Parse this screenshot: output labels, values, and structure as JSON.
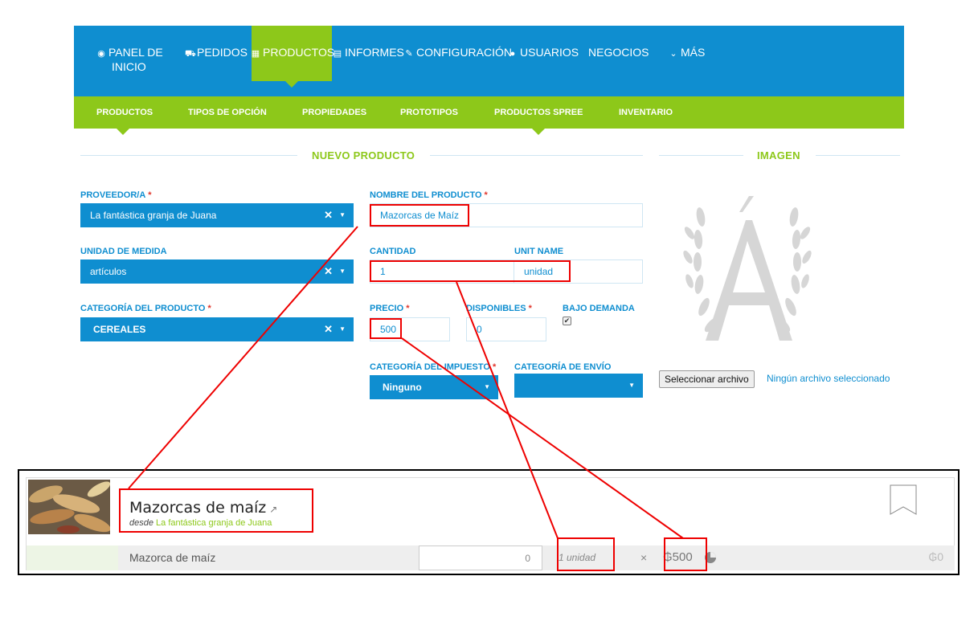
{
  "topnav": {
    "items": [
      {
        "icon": "dashboard-icon",
        "glyph": "◉",
        "label_line1": "PANEL DE",
        "label_line2": "INICIO"
      },
      {
        "icon": "cart-icon",
        "glyph": "⛟",
        "label": "PEDIDOS"
      },
      {
        "icon": "grid-icon",
        "glyph": "▦",
        "label": "PRODUCTOS"
      },
      {
        "icon": "document-icon",
        "glyph": "▤",
        "label": "INFORMES"
      },
      {
        "icon": "wrench-icon",
        "glyph": "✎",
        "label": "CONFIGURACIÓN"
      },
      {
        "icon": "user-icon",
        "glyph": "●",
        "label": "USUARIOS"
      },
      {
        "label": "NEGOCIOS"
      },
      {
        "icon": "chevron-down-icon",
        "glyph": "⌄",
        "label": "MÁS"
      }
    ],
    "active": "PRODUCTOS",
    "colors": {
      "bar": "#0f8ed0",
      "active": "#8dc81a"
    }
  },
  "subnav": {
    "items": [
      "PRODUCTOS",
      "TIPOS DE OPCIÓN",
      "PROPIEDADES",
      "PROTOTIPOS",
      "PRODUCTOS SPREE",
      "INVENTARIO"
    ]
  },
  "sections": {
    "new_product": "NUEVO PRODUCTO",
    "image": "IMAGEN"
  },
  "form": {
    "supplier": {
      "label": "PROVEEDOR/A",
      "required": "*",
      "value": "La fantástica granja de Juana"
    },
    "unit": {
      "label": "UNIDAD DE MEDIDA",
      "value": "artículos"
    },
    "category": {
      "label": "CATEGORÍA DEL PRODUCTO",
      "required": "*",
      "value": "CEREALES"
    },
    "name": {
      "label": "NOMBRE DEL PRODUCTO",
      "required": "*",
      "value": "Mazorcas de Maíz"
    },
    "quantity": {
      "label": "CANTIDAD",
      "value": "1"
    },
    "unit_name": {
      "label": "UNIT NAME",
      "value": "unidad"
    },
    "price": {
      "label": "PRECIO",
      "required": "*",
      "value": "500"
    },
    "available": {
      "label": "DISPONIBLES",
      "required": "*",
      "value": "0"
    },
    "on_demand": {
      "label": "BAJO DEMANDA",
      "checked": true,
      "glyph": "✔"
    },
    "tax_category": {
      "label": "CATEGORÍA DEL IMPUESTO",
      "required": "*",
      "value": "Ninguno"
    },
    "shipping_category": {
      "label": "CATEGORÍA DE ENVÍO",
      "value": ""
    },
    "clear_glyph": "✕",
    "arrow_glyph": "▼"
  },
  "file": {
    "button": "Seleccionar archivo",
    "status": "Ningún archivo seleccionado"
  },
  "card": {
    "title": "Mazorcas de maíz",
    "external_glyph": "↗",
    "from": "desde",
    "supplier": "La fantástica granja de Juana",
    "variant": "Mazorca de maíz",
    "qty": "0",
    "unit": "1 unidad",
    "times": "×",
    "price": "₲500",
    "total": "₲0"
  },
  "annotation_color": "#e00000"
}
